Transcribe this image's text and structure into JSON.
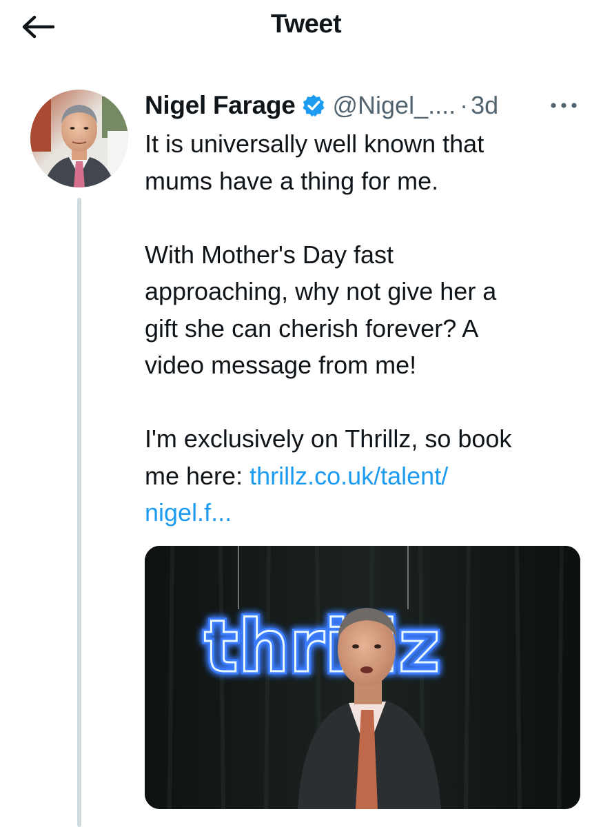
{
  "header": {
    "title": "Tweet",
    "back_icon": "arrow-left-icon"
  },
  "tweet": {
    "author_name": "Nigel Farage",
    "verified_icon": "verified-badge-icon",
    "handle": "@Nigel_....",
    "separator": "·",
    "time": "3d",
    "more_icon": "more-dots-icon",
    "body": {
      "line1": "It is universally well known that",
      "line2": "mums have a thing for me.",
      "line3": "With Mother's Day fast",
      "line4": "approaching, why not give her a",
      "line5": "gift she can cherish forever? A",
      "line6": "video message from me!",
      "line7": "I'm exclusively on Thrillz, so book",
      "line8_prefix": "me here: ",
      "link_part1": "thrillz.co.uk/talent/",
      "link_part2": "nigel.f..."
    },
    "media": {
      "neon_sign_text": "thrillz"
    }
  },
  "colors": {
    "link": "#1d9bf0",
    "secondary_text": "#536471",
    "verified": "#1d9bf0",
    "neon": "#7fd4ff"
  }
}
